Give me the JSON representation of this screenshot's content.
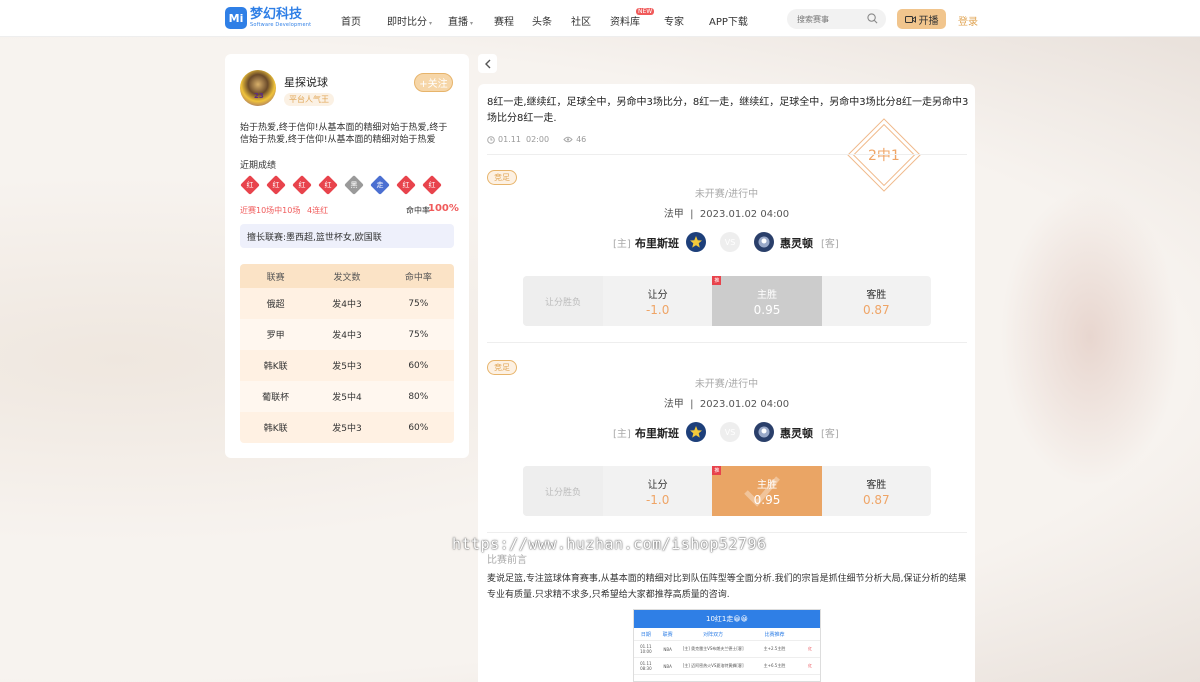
{
  "header": {
    "logo_mark": "Mi",
    "logo_name": "梦幻科技",
    "logo_sub": "Software Development",
    "nav": [
      {
        "label": "首页",
        "caret": false
      },
      {
        "label": "即时比分",
        "caret": true
      },
      {
        "label": "直播",
        "caret": true
      },
      {
        "label": "赛程",
        "caret": false
      },
      {
        "label": "头条",
        "caret": false
      },
      {
        "label": "社区",
        "caret": false
      },
      {
        "label": "资料库",
        "caret": false,
        "badge": "NEW"
      },
      {
        "label": "专家",
        "caret": false
      },
      {
        "label": "APP下载",
        "caret": false
      }
    ],
    "search_placeholder": "搜索赛事",
    "live_button": "开播",
    "login": "登录"
  },
  "expert": {
    "name": "星探说球",
    "avatar_number": "23",
    "badge": "平台人气王",
    "follow": "+关注",
    "bio": "始于热爱,终于信仰!从基本面的精细对始于热爱,终于信始于热爱,终于信仰!从基本面的精细对始于热爱",
    "recent_title": "近期成绩",
    "results": [
      {
        "label": "红",
        "color": "#e8434c"
      },
      {
        "label": "红",
        "color": "#e8434c"
      },
      {
        "label": "红",
        "color": "#e8434c"
      },
      {
        "label": "红",
        "color": "#e8434c"
      },
      {
        "label": "黑",
        "color": "#9a9a9a"
      },
      {
        "label": "走",
        "color": "#4b6fd1"
      },
      {
        "label": "红",
        "color": "#e8434c"
      },
      {
        "label": "红",
        "color": "#e8434c"
      }
    ],
    "streak_text": "近赛10场中10场",
    "streak_count": "4连红",
    "hit_rate_label": "命中率",
    "hit_rate": "100%",
    "leagues": "擅长联赛:墨西超,篮世杯女,欧国联",
    "table": {
      "headers": [
        "联赛",
        "发文数",
        "命中率"
      ],
      "rows": [
        [
          "俄超",
          "发4中3",
          "75%"
        ],
        [
          "罗甲",
          "发4中3",
          "75%"
        ],
        [
          "韩K联",
          "发5中3",
          "60%"
        ],
        [
          "葡联杯",
          "发5中4",
          "80%"
        ],
        [
          "韩K联",
          "发5中3",
          "60%"
        ]
      ]
    }
  },
  "article": {
    "title": "8红一走,继续红，足球全中，另命中3场比分，8红一走，继续红，足球全中，另命中3场比分8红一走另命中3场比分8红一走.",
    "date": "01.11",
    "time": "02:00",
    "views": "46",
    "stamp": "2中1",
    "matches": [
      {
        "tag": "竞足",
        "status": "未开赛/进行中",
        "league": "法甲",
        "datetime": "2023.01.02  04:00",
        "home_tag": "[主]",
        "home": "布里斯班",
        "vs": "VS",
        "away": "惠灵顿",
        "away_tag": "[客]",
        "odds_label": "让分胜负",
        "odds": [
          {
            "title": "让分",
            "value": "-1.0",
            "rec": ""
          },
          {
            "title": "主胜",
            "value": "0.95",
            "rec": "推"
          },
          {
            "title": "客胜",
            "value": "0.87",
            "rec": ""
          }
        ],
        "selected_style": "gray"
      },
      {
        "tag": "竞足",
        "status": "未开赛/进行中",
        "league": "法甲",
        "datetime": "2023.01.02  04:00",
        "home_tag": "[主]",
        "home": "布里斯班",
        "vs": "VS",
        "away": "惠灵顿",
        "away_tag": "[客]",
        "odds_label": "让分胜负",
        "odds": [
          {
            "title": "让分",
            "value": "-1.0",
            "rec": ""
          },
          {
            "title": "主胜",
            "value": "0.95",
            "rec": "推"
          },
          {
            "title": "客胜",
            "value": "0.87",
            "rec": ""
          }
        ],
        "selected_style": "orange"
      }
    ],
    "preview_title": "比赛前言",
    "preview_text": "麦说足篮,专注篮球体育赛事,从基本面的精细对比到队伍阵型等全面分析.我们的宗旨是抓住细节分析大局,保证分析的结果专业有质量.只求精不求多,只希望给大家都推荐高质量的咨询.",
    "image": {
      "header": "10红1走😀😀",
      "cols": [
        "日期",
        "联赛",
        "对阵双方",
        "比赛推荐"
      ],
      "rows": [
        [
          "01.11  10:00",
          "NBA",
          "[主] 奥克雷主VS布朗夫兰德士[客]",
          "主+2.5主胜",
          "红"
        ],
        [
          "01.11  08:30",
          "NBA",
          "[主] 迈阿密热火VS夏洛特黄蜂[客]",
          "主+6.5主胜",
          "红"
        ]
      ]
    }
  },
  "watermark": "https://www.huzhan.com/ishop52796"
}
